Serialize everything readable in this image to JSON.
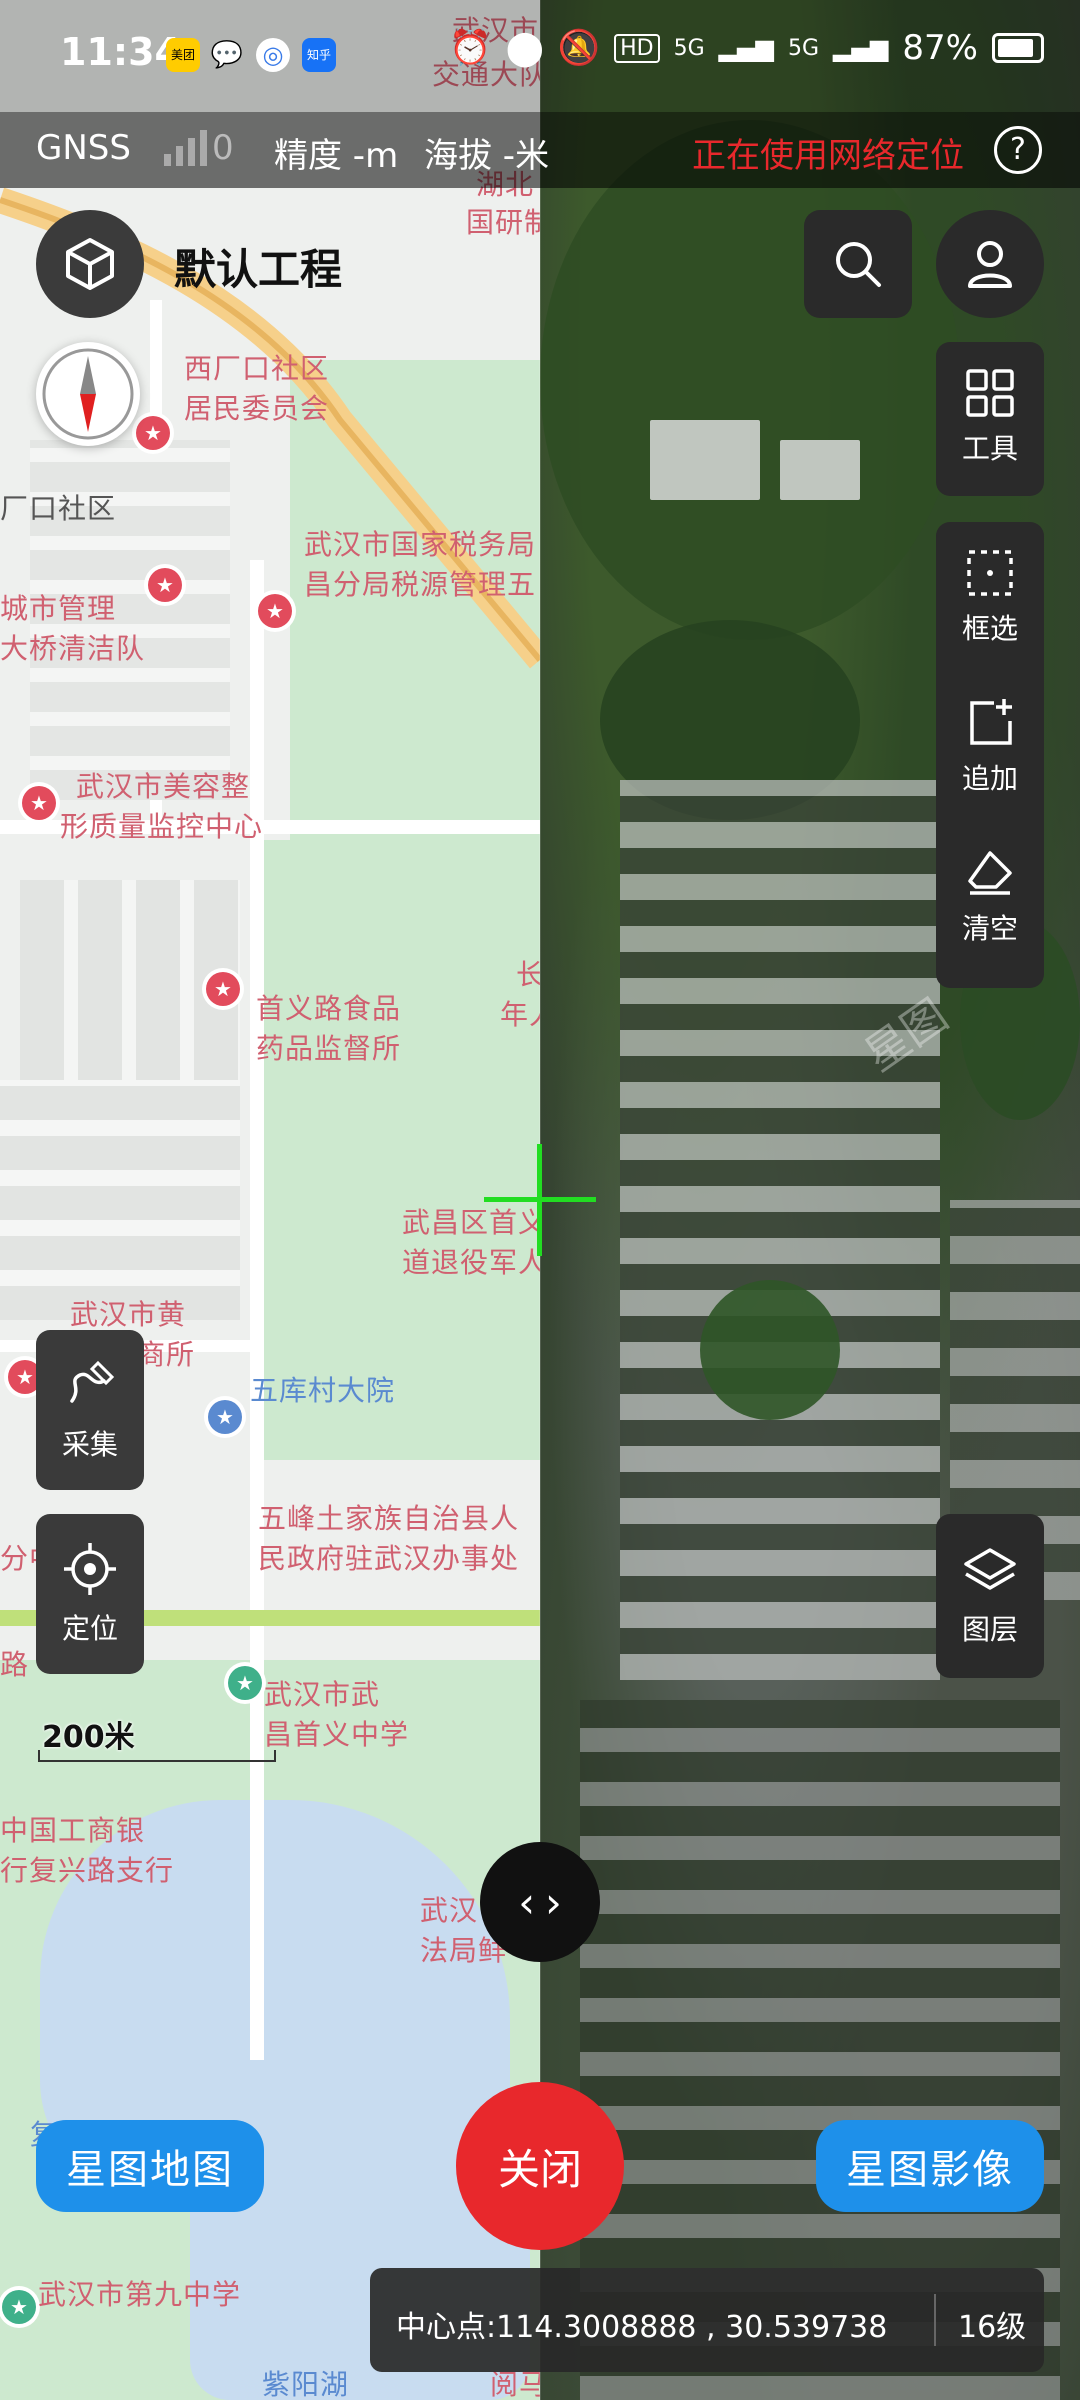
{
  "status_bar": {
    "time": "11:34",
    "apps": [
      "美团",
      "💬",
      "◎",
      "知乎"
    ],
    "network": "5G",
    "battery": "87%"
  },
  "gnss_bar": {
    "label": "GNSS",
    "satellite_count": "0",
    "precision": "精度 -m",
    "altitude": "海拔 -米",
    "network_location": "正在使用网络定位",
    "help": "?"
  },
  "project": {
    "title": "默认工程"
  },
  "toolbar": {
    "tools_label": "工具",
    "box_select_label": "框选",
    "append_label": "追加",
    "clear_label": "清空",
    "layers_label": "图层"
  },
  "side": {
    "collect_label": "采集",
    "locate_label": "定位"
  },
  "map": {
    "scale": "200米",
    "watermark": "星图"
  },
  "poi": [
    "武汉市",
    "交通大队",
    "湖北",
    "国研制",
    "西厂口社区",
    "居民委员会",
    "厂口社区",
    "武汉市国家税务局",
    "昌分局税源管理五",
    "城市管理",
    "大桥清洁队",
    "武汉市美容整",
    "形质量监控中心",
    "首义路食品",
    "药品监督所",
    "长",
    "年人",
    "武昌区首义",
    "道退役军人",
    "武汉市黄",
    "鹤楼工商所",
    "五库村大院",
    "五峰土家族自治县人",
    "民政府驻武汉办事处",
    "武汉市武",
    "昌首义中学",
    "中国工商银",
    "行复兴路支行",
    "武汉",
    "法局鲜",
    "复兴路社区",
    "武汉市第九中学",
    "紫阳湖",
    "阅马场",
    "分中",
    "路"
  ],
  "bottom": {
    "map_button": "星图地图",
    "close_button": "关闭",
    "image_button": "星图影像",
    "center_point": "中心点:114.3008888 , 30.539738",
    "zoom": "16级"
  }
}
